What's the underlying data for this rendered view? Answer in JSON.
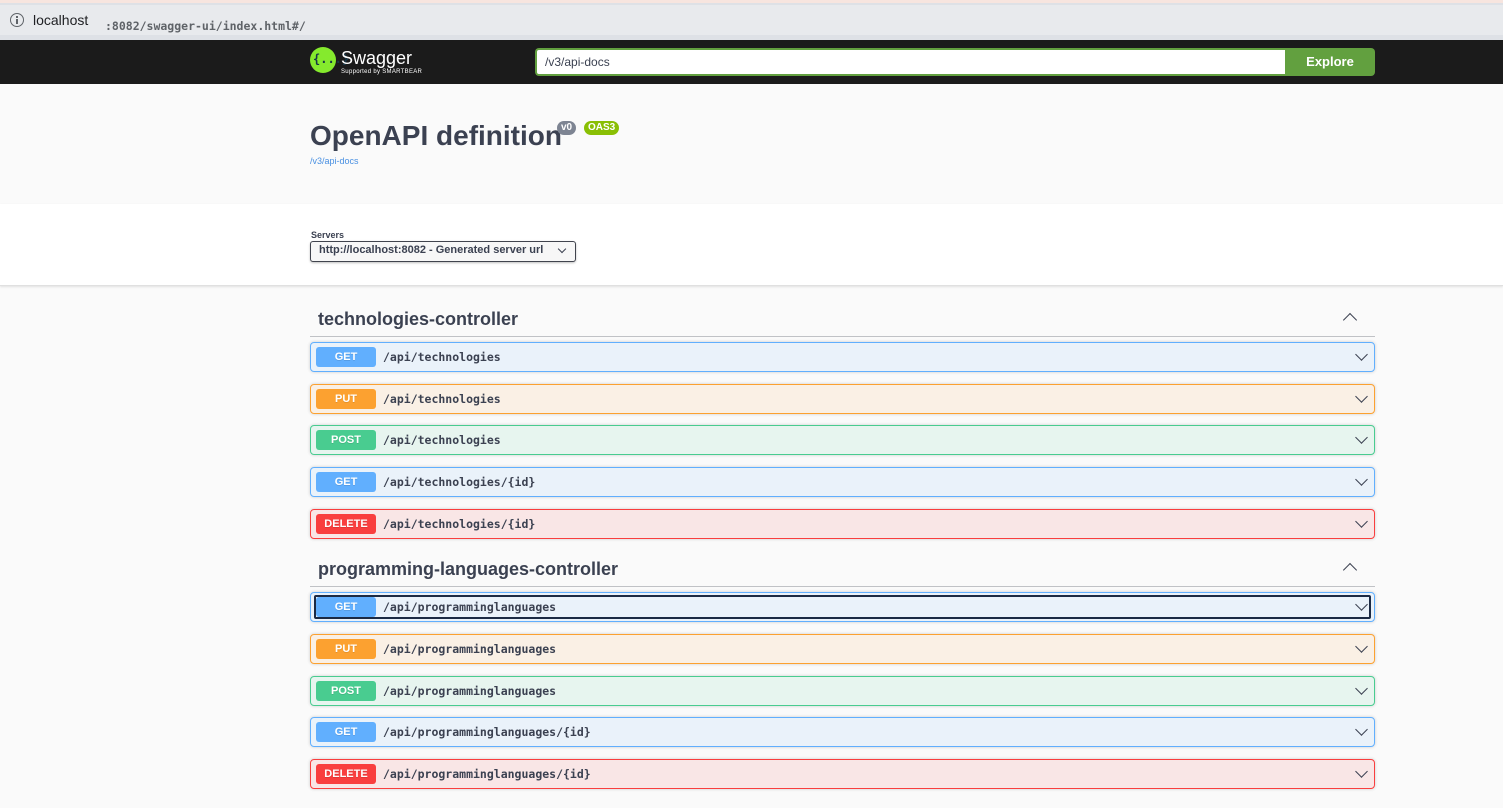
{
  "browser": {
    "url_host": "localhost",
    "url_rest": ":8082/swagger-ui/index.html#/"
  },
  "topbar": {
    "logo_glyph": "{...}",
    "logo_title": "Swagger",
    "logo_sub": "Supported by SMARTBEAR",
    "explore_value": "/v3/api-docs",
    "explore_label": "Explore"
  },
  "info": {
    "title": "OpenAPI definition",
    "version_badge": "v0",
    "oas_badge": "OAS3",
    "spec_link": "/v3/api-docs"
  },
  "servers": {
    "label": "Servers",
    "selected": "http://localhost:8082 - Generated server url"
  },
  "tags": [
    {
      "name": "technologies-controller",
      "operations": [
        {
          "method": "GET",
          "path": "/api/technologies"
        },
        {
          "method": "PUT",
          "path": "/api/technologies"
        },
        {
          "method": "POST",
          "path": "/api/technologies"
        },
        {
          "method": "GET",
          "path": "/api/technologies/{id}"
        },
        {
          "method": "DELETE",
          "path": "/api/technologies/{id}"
        }
      ]
    },
    {
      "name": "programming-languages-controller",
      "operations": [
        {
          "method": "GET",
          "path": "/api/programminglanguages"
        },
        {
          "method": "PUT",
          "path": "/api/programminglanguages"
        },
        {
          "method": "POST",
          "path": "/api/programminglanguages"
        },
        {
          "method": "GET",
          "path": "/api/programminglanguages/{id}"
        },
        {
          "method": "DELETE",
          "path": "/api/programminglanguages/{id}"
        }
      ]
    }
  ],
  "colors": {
    "get": "#61affe",
    "put": "#fca130",
    "post": "#49cc90",
    "delete": "#f93e3e",
    "topbar": "#1b1b1b",
    "explore": "#62a03f"
  }
}
